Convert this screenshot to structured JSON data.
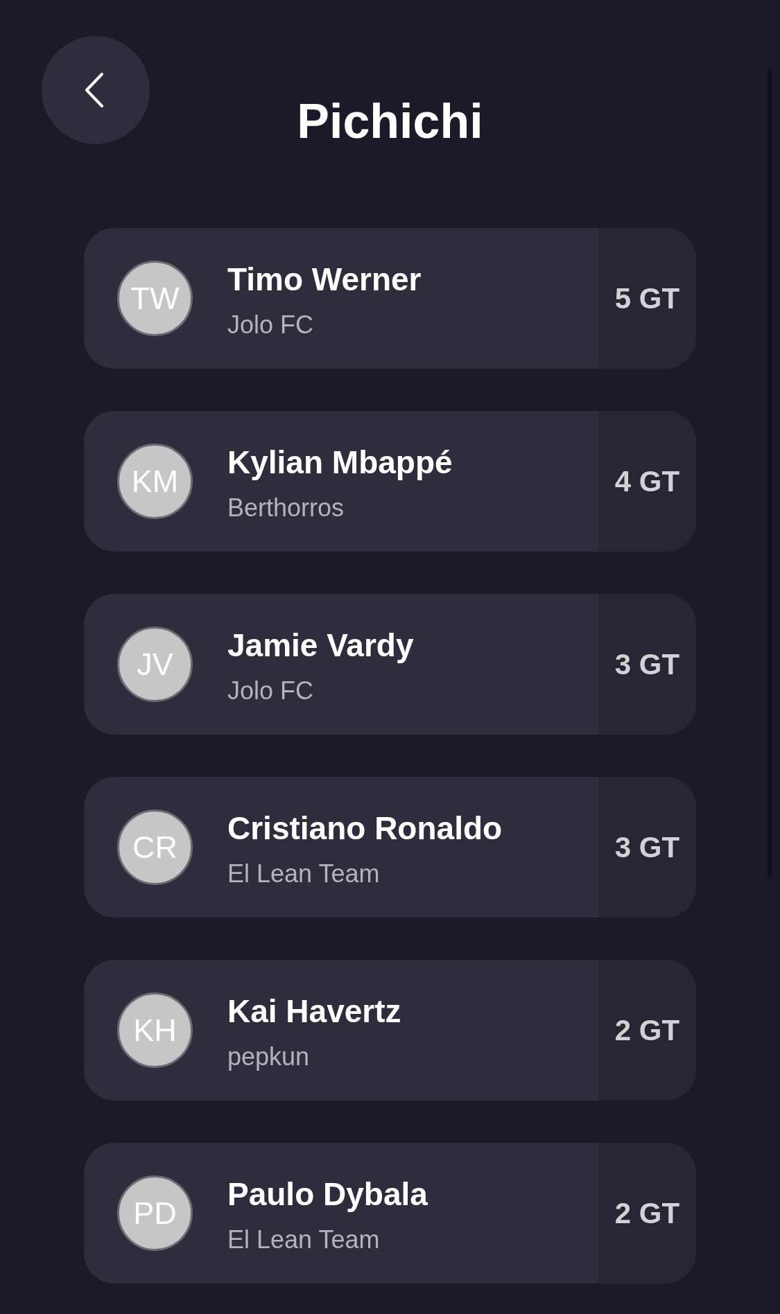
{
  "title": "Pichichi",
  "players": [
    {
      "initials": "TW",
      "name": "Timo Werner",
      "team": "Jolo FC",
      "goals": "5 GT"
    },
    {
      "initials": "KM",
      "name": "Kylian Mbappé",
      "team": "Berthorros",
      "goals": "4 GT"
    },
    {
      "initials": "JV",
      "name": "Jamie Vardy",
      "team": "Jolo FC",
      "goals": "3 GT"
    },
    {
      "initials": "CR",
      "name": "Cristiano Ronaldo",
      "team": "El Lean Team",
      "goals": "3 GT"
    },
    {
      "initials": "KH",
      "name": "Kai Havertz",
      "team": "pepkun",
      "goals": "2 GT"
    },
    {
      "initials": "PD",
      "name": "Paulo Dybala",
      "team": "El Lean Team",
      "goals": "2 GT"
    }
  ]
}
